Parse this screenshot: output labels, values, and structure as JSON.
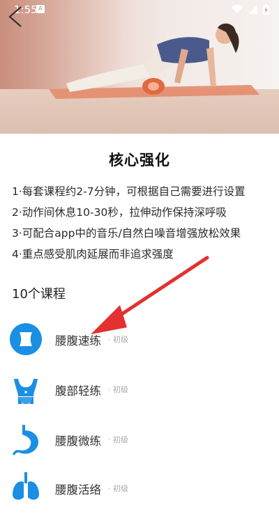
{
  "status": {
    "time": "1:55",
    "notif_letter": "A"
  },
  "page": {
    "title": "核心强化",
    "tips": [
      "1·每套课程约2-7分钟，可根据自己需要进行设置",
      "2·动作间休息10-30秒，拉伸动作保持深呼吸",
      "3·可配合app中的音乐/自然白噪音增强放松效果",
      "4·重点感受肌肉延展而非追求强度"
    ],
    "course_count": "10个课程"
  },
  "courses": [
    {
      "name": "腰腹速练",
      "level": "· 初级",
      "icon": "waist-icon"
    },
    {
      "name": "腹部轻练",
      "level": "· 初级",
      "icon": "abdomen-icon"
    },
    {
      "name": "腰腹微练",
      "level": "· 初级",
      "icon": "stomach-icon"
    },
    {
      "name": "腰腹活络",
      "level": "· 初级",
      "icon": "lungs-icon"
    }
  ],
  "colors": {
    "accent": "#1a8fe3",
    "arrow": "#e53030"
  }
}
